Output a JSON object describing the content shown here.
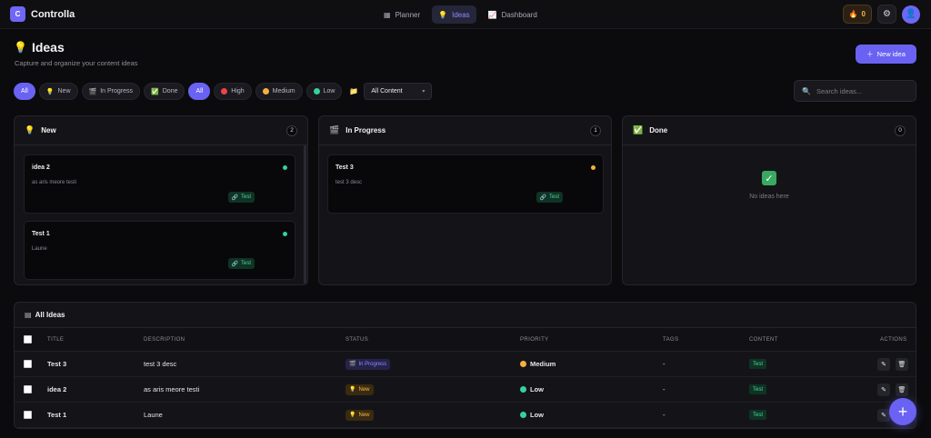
{
  "app": {
    "logo_letter": "C",
    "name": "Controlla"
  },
  "nav": [
    {
      "label": "Planner",
      "icon": "calendar-icon",
      "active": false
    },
    {
      "label": "Ideas",
      "icon": "lightbulb-icon",
      "active": true
    },
    {
      "label": "Dashboard",
      "icon": "chart-icon",
      "active": false
    }
  ],
  "topbar": {
    "streak_count": "0"
  },
  "page": {
    "title": "Ideas",
    "subtitle": "Capture and organize your content ideas",
    "new_idea_label": "New idea"
  },
  "filters": {
    "status": [
      "All",
      "New",
      "In Progress",
      "Done"
    ],
    "priority": [
      "All",
      "High",
      "Medium",
      "Low"
    ],
    "content_select": "All Content",
    "search_placeholder": "Search ideas..."
  },
  "board": {
    "columns": [
      {
        "title": "New",
        "count": "2"
      },
      {
        "title": "In Progress",
        "count": "1"
      },
      {
        "title": "Done",
        "count": "0",
        "empty_text": "No ideas here"
      }
    ],
    "cards": {
      "new": [
        {
          "title": "idea 2",
          "desc": "as aris meore testi",
          "tag": "Test",
          "priority_color": "#34d399"
        },
        {
          "title": "Test 1",
          "desc": "Laune",
          "tag": "Test",
          "priority_color": "#34d399"
        }
      ],
      "in_progress": [
        {
          "title": "Test 3",
          "desc": "test 3 desc",
          "tag": "Test",
          "priority_color": "#f5b041"
        }
      ]
    }
  },
  "table": {
    "title": "All Ideas",
    "headers": [
      "TITLE",
      "DESCRIPTION",
      "STATUS",
      "PRIORITY",
      "TAGS",
      "CONTENT",
      "ACTIONS"
    ],
    "rows": [
      {
        "title": "Test 3",
        "desc": "test 3 desc",
        "status": "In Progress",
        "priority": "Medium",
        "tags": "-",
        "content": "Test"
      },
      {
        "title": "idea 2",
        "desc": "as aris meore testi",
        "status": "New",
        "priority": "Low",
        "tags": "-",
        "content": "Test"
      },
      {
        "title": "Test 1",
        "desc": "Laune",
        "status": "New",
        "priority": "Low",
        "tags": "-",
        "content": "Test"
      }
    ]
  },
  "colors": {
    "accent": "#6a62f2",
    "high": "#ef4444",
    "medium": "#f5b041",
    "low": "#34d399"
  }
}
